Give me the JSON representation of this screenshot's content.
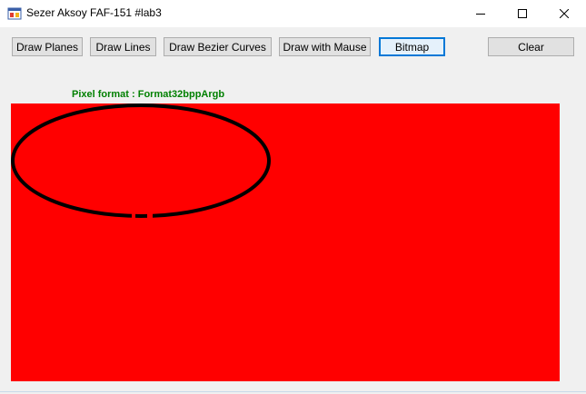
{
  "window": {
    "title": "Sezer Aksoy FAF-151 #lab3",
    "controls": {
      "minimize": "minimize-icon",
      "maximize": "maximize-icon",
      "close": "close-icon"
    }
  },
  "toolbar": {
    "draw_planes": "Draw Planes",
    "draw_lines": "Draw Lines",
    "draw_bezier": "Draw Bezier Curves",
    "draw_mouse": "Draw with Mause",
    "bitmap": "Bitmap",
    "clear": "Clear"
  },
  "status": {
    "pixel_format": "Pixel format : Format32bppArgb"
  },
  "canvas": {
    "background_color": "#ff0000",
    "ellipse_color": "#000000",
    "shape": "ellipse"
  },
  "colors": {
    "label_green": "#008000",
    "focus_blue": "#0078d7"
  }
}
